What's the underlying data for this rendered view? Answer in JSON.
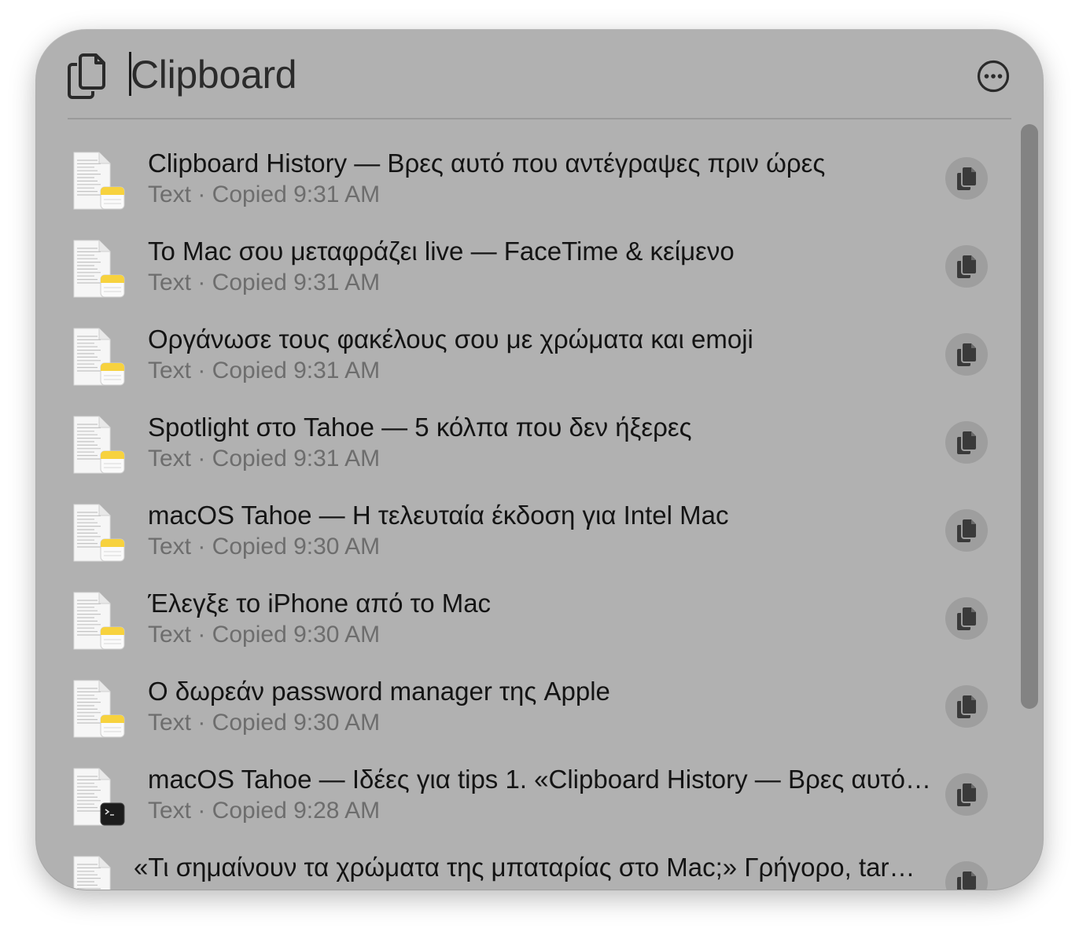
{
  "search": {
    "value": "Clipboard"
  },
  "header": {
    "leading_icon": "clipboard-icon",
    "more_icon": "ellipsis-circle-icon"
  },
  "items": [
    {
      "title": "Clipboard History — Βρες αυτό που αντέγραψες πριν ώρες",
      "subtitle": "Text · Copied 9:31 AM",
      "app_icon": "notes-icon"
    },
    {
      "title": "Το Mac σου μεταφράζει live — FaceTime & κείμενο",
      "subtitle": "Text · Copied 9:31 AM",
      "app_icon": "notes-icon"
    },
    {
      "title": "Οργάνωσε τους φακέλους σου με χρώματα και emoji",
      "subtitle": "Text · Copied 9:31 AM",
      "app_icon": "notes-icon"
    },
    {
      "title": "Spotlight στο Tahoe — 5 κόλπα που δεν ήξερες",
      "subtitle": "Text · Copied 9:31 AM",
      "app_icon": "notes-icon"
    },
    {
      "title": "macOS Tahoe — Η τελευταία έκδοση για Intel Mac",
      "subtitle": "Text · Copied 9:30 AM",
      "app_icon": "notes-icon"
    },
    {
      "title": "Έλεγξε το iPhone από το Mac",
      "subtitle": "Text · Copied 9:30 AM",
      "app_icon": "notes-icon"
    },
    {
      "title": "Ο δωρεάν password manager της Apple",
      "subtitle": "Text · Copied 9:30 AM",
      "app_icon": "notes-icon"
    },
    {
      "title": " macOS Tahoe — Ιδέες για tips 1. «Clipboard History — Βρες αυτό…",
      "subtitle": "Text · Copied 9:28 AM",
      "app_icon": "terminal-icon"
    },
    {
      "title": "«Τι σημαίνουν τα χρώματα της μπαταρίας στο Mac;» Γρήγορο, tar…",
      "subtitle": "",
      "app_icon": "notes-icon"
    }
  ],
  "colors": {
    "panel": "#b1b1b1",
    "copy_button": "#9e9e9e",
    "scroll_thumb": "#838383",
    "notes_accent": "#f7d23e"
  }
}
